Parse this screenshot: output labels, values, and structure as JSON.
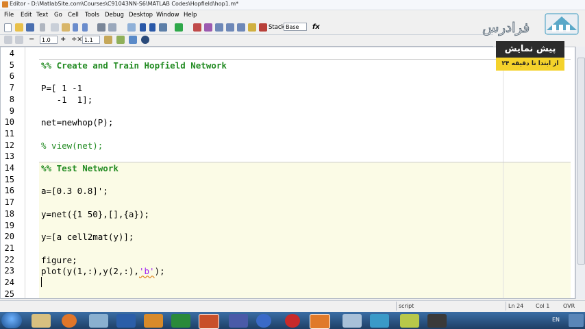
{
  "window": {
    "title": "Editor - D:\\MatlabSite.com\\Courses\\C91043NN-S6\\MATLAB Codes\\Hopfield\\hop1.m*"
  },
  "menu": [
    "File",
    "Edit",
    "Text",
    "Go",
    "Cell",
    "Tools",
    "Debug",
    "Desktop",
    "Window",
    "Help"
  ],
  "toolbar": {
    "stack_label": "Stack:",
    "stack_value": "Base",
    "fx": "fx"
  },
  "cell_toolbar": {
    "minus": "−",
    "value1": "1.0",
    "plus": "+",
    "divide": "÷",
    "times": "×",
    "value2": "1.1"
  },
  "lines": [
    {
      "n": "4",
      "text": ""
    },
    {
      "n": "5",
      "text": "%% Create and Train Hopfield Network",
      "kind": "cellhead"
    },
    {
      "n": "6",
      "text": ""
    },
    {
      "n": "7",
      "text": "P=[ 1 -1"
    },
    {
      "n": "8",
      "text": "   -1  1];"
    },
    {
      "n": "9",
      "text": ""
    },
    {
      "n": "10",
      "text": "net=newhop(P);"
    },
    {
      "n": "11",
      "text": ""
    },
    {
      "n": "12",
      "text": "% view(net);",
      "kind": "comment"
    },
    {
      "n": "13",
      "text": ""
    },
    {
      "n": "14",
      "text": "%% Test Network",
      "kind": "cellhead"
    },
    {
      "n": "15",
      "text": ""
    },
    {
      "n": "16",
      "text": "a=[0.3 0.8]';"
    },
    {
      "n": "17",
      "text": ""
    },
    {
      "n": "18",
      "text": "y=net({1 50},[],{a});"
    },
    {
      "n": "19",
      "text": ""
    },
    {
      "n": "20",
      "text": "y=[a cell2mat(y)];"
    },
    {
      "n": "21",
      "text": ""
    },
    {
      "n": "22",
      "text": "figure;"
    },
    {
      "n": "23",
      "text_pre": "plot(y(1,:),y(2,:),",
      "text_str": "'b'",
      "text_post": ");"
    },
    {
      "n": "24",
      "text": ""
    },
    {
      "n": "25",
      "text": ""
    }
  ],
  "status": {
    "script": "script",
    "ln": "Ln  24",
    "col": "Col  1",
    "ovr": "OVR"
  },
  "overlay": {
    "logo_text": "فرادرس",
    "promo_title": "پیش نمایش",
    "promo_sub": "از ابتدا تا دقیقه ۲۴"
  },
  "taskbar": {
    "lang": "EN"
  },
  "colors": {
    "cell_highlight": "#fbfbe6",
    "comment": "#228b22",
    "string": "#a020f0",
    "promo_yellow": "#f4d22b"
  }
}
